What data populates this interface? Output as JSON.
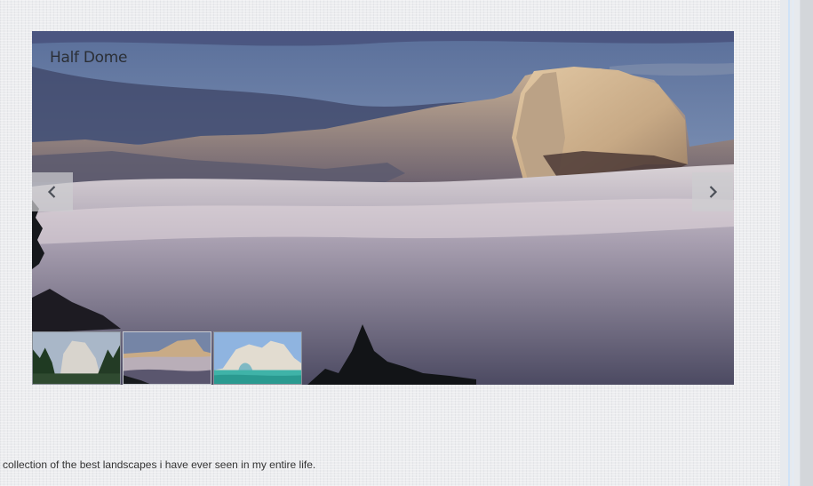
{
  "gallery": {
    "caption": "Half Dome",
    "prev_icon": "chevron-left-icon",
    "next_icon": "chevron-right-icon",
    "thumbnails": [
      {
        "name": "thumbnail-el-capitan"
      },
      {
        "name": "thumbnail-half-dome"
      },
      {
        "name": "thumbnail-sea-arch"
      }
    ]
  },
  "description": "collection of the best landscapes i have ever seen in my entire life."
}
